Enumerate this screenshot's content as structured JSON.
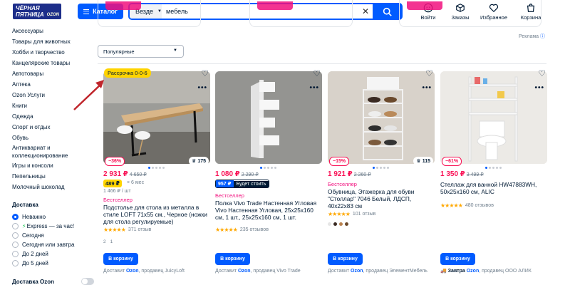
{
  "header": {
    "logo_text": "ЧЁРНАЯ ПЯТНИЦА",
    "logo_sub": "OZON",
    "catalog_label": "Каталог",
    "search": {
      "scope": "Везде",
      "value": "мебель",
      "clear_icon": "close-icon",
      "submit_icon": "search-icon"
    },
    "icons": [
      {
        "label": "Войти",
        "icon": "user-icon"
      },
      {
        "label": "Заказы",
        "icon": "box-icon"
      },
      {
        "label": "Избранное",
        "icon": "heart-icon"
      },
      {
        "label": "Корзина",
        "icon": "cart-icon"
      }
    ]
  },
  "sidebar": {
    "categories": [
      "Аксессуары",
      "Товары для животных",
      "Хобби и творчество",
      "Канцелярские товары",
      "Автотовары",
      "Аптека",
      "Ozon Услуги",
      "Книги",
      "Одежда",
      "Спорт и отдых",
      "Обувь",
      "Антиквариат и коллекционирование",
      "Игры и консоли",
      "Пепельницы",
      "Молочный шоколад"
    ],
    "delivery_title": "Доставка",
    "delivery_options": [
      "Неважно",
      "Express — за час!",
      "Сегодня",
      "Сегодня или завтра",
      "До 2 дней",
      "До 5 дней"
    ],
    "delivery_selected": "Неважно",
    "ozon_delivery": "Доставка Ozon"
  },
  "ad_label": "Реклама",
  "sort_label": "Популярные",
  "promo_badge": "Рассрочка 0-0-6",
  "products": [
    {
      "discount": "−36%",
      "rating_badge": "175",
      "price": "2 931 ₽",
      "old_price": "4 650 ₽",
      "installment": "489 ₽",
      "installment_months": "× 6 мес",
      "unit_price": "1 466 ₽ / шт",
      "badge": "Бестселлер",
      "title": "Подстолье для стола из металла в стиле LOFT 71x55 см., Черное (ножки для стола регулируемые)",
      "reviews": "371 отзыв",
      "pages": [
        "2",
        "1"
      ],
      "cart_label": "В корзину",
      "delivery": "Доставит",
      "delivery_brand": "Ozon",
      "seller": ", продавец JuicyLoft"
    },
    {
      "price": "1 080 ₽",
      "old_price": "2 290 ₽",
      "will_cost_value": "957 ₽",
      "will_cost_label": "Будет стоить",
      "badge": "Бестселлер",
      "title": "Полка Vivo Trade Настенная Угловая Vivo Настенная Угловая, 25x25x160 см, 1 шт., 25x25x160 см, 1 шт.",
      "reviews": "235 отзывов",
      "cart_label": "В корзину",
      "delivery": "Доставит",
      "delivery_brand": "Ozon",
      "seller": ", продавец Vivo Trade"
    },
    {
      "discount": "−15%",
      "rating_badge": "115",
      "price": "1 921 ₽",
      "old_price": "2 260 ₽",
      "badge": "Бестселлер",
      "title": "Обувница, Этажерка для обуви \"Столлар\" 7046 Белый, ЛДСП, 40x22x83 см",
      "reviews": "101 отзыв",
      "swatches": [
        "#e6e6e6",
        "#3a2a22",
        "#b9824f",
        "#6b4a2d"
      ],
      "cart_label": "В корзину",
      "delivery": "Доставит",
      "delivery_brand": "Ozon",
      "seller": ", продавец ЭлементМебель"
    },
    {
      "discount": "−61%",
      "price": "1 350 ₽",
      "old_price": "3 499 ₽",
      "title": "Стеллаж для ванной HW47883WH, 50x25x160 см, ALIC",
      "reviews": "480 отзывов",
      "cart_label": "В корзину",
      "delivery": "Завтра",
      "delivery_brand": "Ozon",
      "seller": ", продавец ООО АЛИК"
    }
  ],
  "colors": {
    "accent": "#005bff",
    "sale": "#f91155",
    "yellow": "#ffd400",
    "text": "#001a34"
  }
}
